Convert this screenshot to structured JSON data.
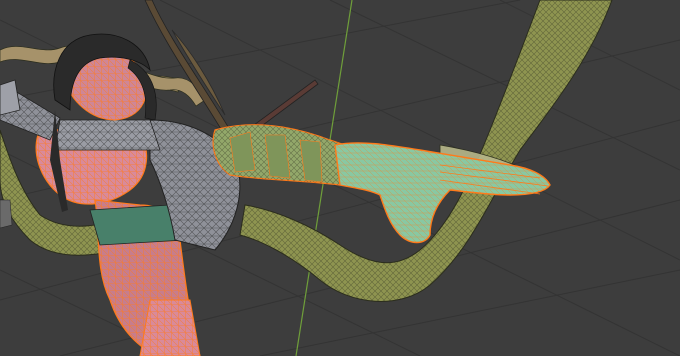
{
  "viewport": {
    "mode": "edit-mode",
    "overlay": "wireframe",
    "grid_visible": true,
    "y_axis_line_color": "#6f9f3a",
    "grid_color": "#333333",
    "background_color": "#3d3d3d"
  },
  "colors": {
    "mesh_olive": "#8e9450",
    "mesh_olive_dark": "#5e6430",
    "mesh_wire": "#2b2d1c",
    "arm_green": "#93a86a",
    "hand_mint": "#89c8a2",
    "selection_orange": "#ff7a1a",
    "skin_pink": "#d98a9a",
    "cloth_grey": "#8f9199",
    "hair_dark": "#2a2a2a",
    "rope_tan": "#a6926a"
  },
  "objects": [
    {
      "name": "character-body",
      "selected": true
    },
    {
      "name": "left-arm",
      "selected": true
    },
    {
      "name": "hand",
      "selected": true
    },
    {
      "name": "tentacle",
      "selected": false
    }
  ]
}
